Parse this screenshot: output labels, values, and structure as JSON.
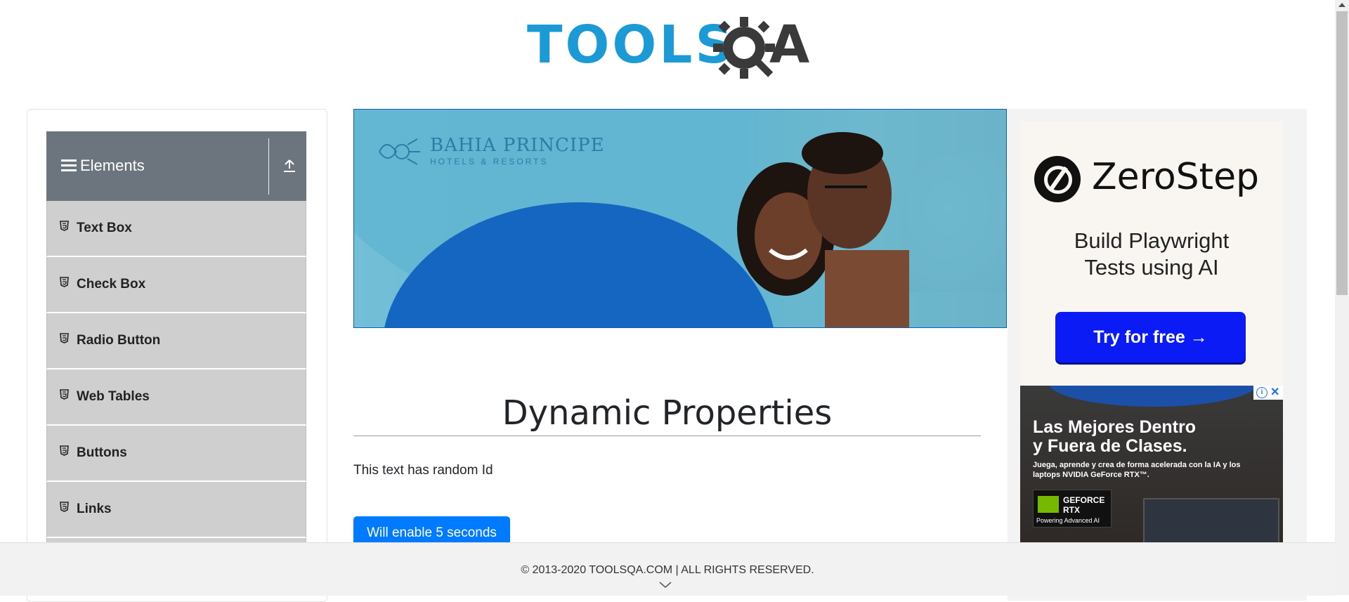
{
  "logo": {
    "text_main": "TOOLS",
    "text_accent": "A",
    "hidden_letter": "Q",
    "alt": "TOOLSQA"
  },
  "sidebar": {
    "group_title": "Elements",
    "items": [
      {
        "label": "Text Box"
      },
      {
        "label": "Check Box"
      },
      {
        "label": "Radio Button"
      },
      {
        "label": "Web Tables"
      },
      {
        "label": "Buttons"
      },
      {
        "label": "Links"
      }
    ]
  },
  "banner_ad": {
    "brand": "BAHIA PRINCIPE",
    "brand_sub": "HOTELS & RESORTS"
  },
  "main": {
    "title": "Dynamic Properties",
    "random_text": "This text has random Id",
    "enable_button": "Will enable 5 seconds"
  },
  "right_ads": {
    "zerostep": {
      "name": "ZeroStep",
      "headline_line1": "Build Playwright",
      "headline_line2": "Tests using AI",
      "cta": "Try for free →"
    },
    "nvidia": {
      "headline_line1": "Las Mejores Dentro",
      "headline_line2": "y Fuera de Clases.",
      "subtext": "Juega, aprende y crea de forma acelerada con la IA y los laptops NVIDIA GeForce RTX™.",
      "badge_line1": "GEFORCE",
      "badge_line2": "RTX",
      "badge_tagline": "Powering Advanced AI"
    }
  },
  "footer": {
    "text": "© 2013-2020 TOOLSQA.COM | ALL RIGHTS RESERVED."
  },
  "colors": {
    "brand_blue": "#1b9ad6",
    "sidebar_header": "#6c757d",
    "menu_item": "#cfcfcf",
    "primary_button": "#007bff",
    "zerostep_cta": "#0a1bf5"
  }
}
